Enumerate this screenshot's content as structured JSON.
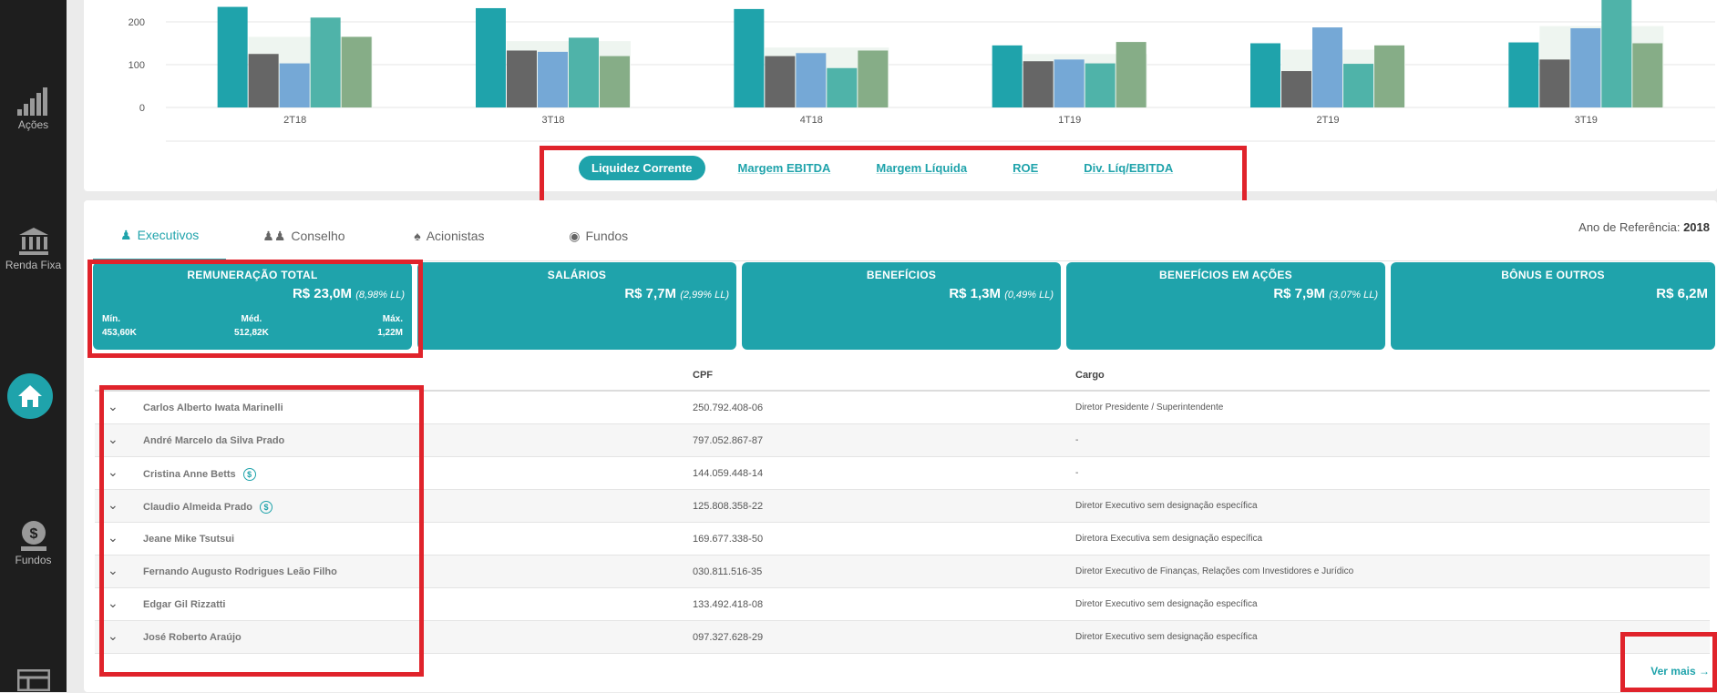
{
  "sidebar": {
    "items": [
      {
        "label": "Ações",
        "icon": "signal-bars-icon"
      },
      {
        "label": "Renda Fixa",
        "icon": "bank-icon"
      },
      {
        "label": "",
        "icon": "home-icon"
      },
      {
        "label": "Fundos",
        "icon": "money-bag-icon"
      },
      {
        "label": "",
        "icon": "table-icon"
      }
    ]
  },
  "chart_data": {
    "type": "bar",
    "categories": [
      "2T18",
      "3T18",
      "4T18",
      "1T19",
      "2T19",
      "3T19"
    ],
    "ylim": [
      0,
      250
    ],
    "yticks": [
      0,
      100,
      200
    ],
    "series": [
      {
        "color": "#1fa3ab",
        "values": [
          235,
          232,
          230,
          145,
          150,
          152
        ]
      },
      {
        "color": "#666666",
        "values": [
          125,
          133,
          120,
          108,
          85,
          112
        ]
      },
      {
        "color": "#75a8d6",
        "values": [
          103,
          130,
          127,
          112,
          187,
          185
        ]
      },
      {
        "color": "#4fb3a9",
        "values": [
          210,
          163,
          92,
          103,
          102,
          255
        ]
      },
      {
        "color": "#86ad87",
        "values": [
          165,
          120,
          133,
          153,
          145,
          150
        ]
      }
    ],
    "background_band": [
      165,
      155,
      140,
      125,
      135,
      190
    ],
    "xlabel": "",
    "ylabel": "",
    "grid": true
  },
  "chart_tabs": [
    "Liquidez Corrente",
    "Margem EBITDA",
    "Margem Líquida",
    "ROE",
    "Div. Líq/EBITDA"
  ],
  "people_tabs": [
    {
      "label": "Executivos",
      "icon": "person-icon"
    },
    {
      "label": "Conselho",
      "icon": "group-icon"
    },
    {
      "label": "Acionistas",
      "icon": "shareholder-icon"
    },
    {
      "label": "Fundos",
      "icon": "fund-icon"
    }
  ],
  "reference": {
    "label": "Ano de Referência:",
    "year": "2018"
  },
  "kpis": [
    {
      "title": "REMUNERAÇÃO TOTAL",
      "value": "R$ 23,0M",
      "pct": "(8,98% LL)",
      "min_label": "Mín.",
      "min": "453,60K",
      "med_label": "Méd.",
      "med": "512,82K",
      "max_label": "Máx.",
      "max": "1,22M"
    },
    {
      "title": "SALÁRIOS",
      "value": "R$ 7,7M",
      "pct": "(2,99% LL)"
    },
    {
      "title": "BENEFÍCIOS",
      "value": "R$ 1,3M",
      "pct": "(0,49% LL)"
    },
    {
      "title": "BENEFÍCIOS EM AÇÕES",
      "value": "R$ 7,9M",
      "pct": "(3,07% LL)"
    },
    {
      "title": "BÔNUS E OUTROS",
      "value": "R$ 6,2M",
      "pct": ""
    }
  ],
  "table": {
    "headers": {
      "cpf": "CPF",
      "cargo": "Cargo"
    },
    "rows": [
      {
        "name": "Carlos Alberto Iwata Marinelli",
        "cpf": "250.792.408-06",
        "cargo": "Diretor Presidente / Superintendente",
        "badge": false
      },
      {
        "name": "André Marcelo da Silva Prado",
        "cpf": "797.052.867-87",
        "cargo": "-",
        "badge": false
      },
      {
        "name": "Cristina Anne Betts",
        "cpf": "144.059.448-14",
        "cargo": "-",
        "badge": true
      },
      {
        "name": "Claudio Almeida Prado",
        "cpf": "125.808.358-22",
        "cargo": "Diretor Executivo sem designação específica",
        "badge": true
      },
      {
        "name": "Jeane Mike Tsutsui",
        "cpf": "169.677.338-50",
        "cargo": "Diretora Executiva sem designação específica",
        "badge": false
      },
      {
        "name": "Fernando Augusto Rodrigues Leão Filho",
        "cpf": "030.811.516-35",
        "cargo": "Diretor Executivo de Finanças, Relações com Investidores e Jurídico",
        "badge": false
      },
      {
        "name": "Edgar Gil Rizzatti",
        "cpf": "133.492.418-08",
        "cargo": "Diretor Executivo sem designação específica",
        "badge": false
      },
      {
        "name": "José Roberto Araújo",
        "cpf": "097.327.628-29",
        "cargo": "Diretor Executivo sem designação específica",
        "badge": false
      }
    ]
  },
  "ver_mais": "Ver mais",
  "colors": {
    "accent": "#1fa3ab",
    "highlight": "#e0232b",
    "sidebar": "#1e1e1e"
  }
}
